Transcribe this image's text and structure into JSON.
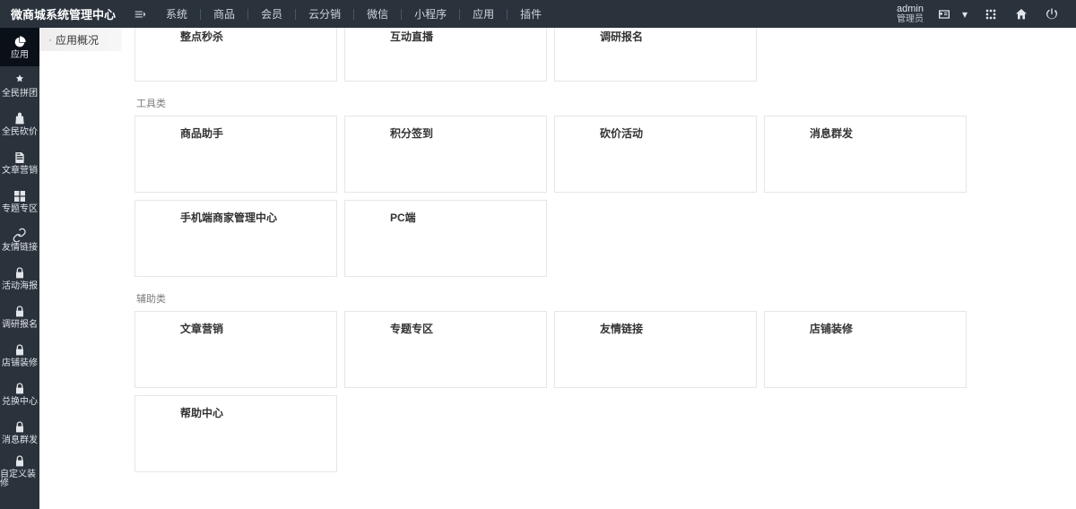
{
  "header": {
    "title": "微商城系统管理中心",
    "nav": [
      "系统",
      "商品",
      "会员",
      "云分销",
      "微信",
      "小程序",
      "应用",
      "插件"
    ],
    "user": {
      "name": "admin",
      "role": "管理员"
    }
  },
  "sidebar": {
    "items": [
      {
        "label": "应用",
        "icon": "pie"
      },
      {
        "label": "全民拼团",
        "icon": "hand"
      },
      {
        "label": "全民砍价",
        "icon": "bag"
      },
      {
        "label": "文章营销",
        "icon": "doc"
      },
      {
        "label": "专题专区",
        "icon": "grid"
      },
      {
        "label": "友情链接",
        "icon": "link"
      },
      {
        "label": "活动海报",
        "icon": "lock"
      },
      {
        "label": "调研报名",
        "icon": "lock"
      },
      {
        "label": "店铺装修",
        "icon": "lock"
      },
      {
        "label": "兑换中心",
        "icon": "lock"
      },
      {
        "label": "消息群发",
        "icon": "lock"
      },
      {
        "label": "自定义装修",
        "icon": "lock"
      }
    ]
  },
  "sub_sidebar": {
    "items": [
      "应用概况"
    ]
  },
  "sections": [
    {
      "title": "",
      "cards": [
        {
          "title": "整点秒杀"
        },
        {
          "title": "互动直播"
        },
        {
          "title": "调研报名"
        }
      ]
    },
    {
      "title": "工具类",
      "cards": [
        {
          "title": "商品助手"
        },
        {
          "title": "积分签到"
        },
        {
          "title": "砍价活动"
        },
        {
          "title": "消息群发"
        },
        {
          "title": "手机端商家管理中心"
        },
        {
          "title": "PC端"
        }
      ]
    },
    {
      "title": "辅助类",
      "cards": [
        {
          "title": "文章营销"
        },
        {
          "title": "专题专区"
        },
        {
          "title": "友情链接"
        },
        {
          "title": "店铺装修"
        },
        {
          "title": "帮助中心"
        }
      ]
    }
  ]
}
